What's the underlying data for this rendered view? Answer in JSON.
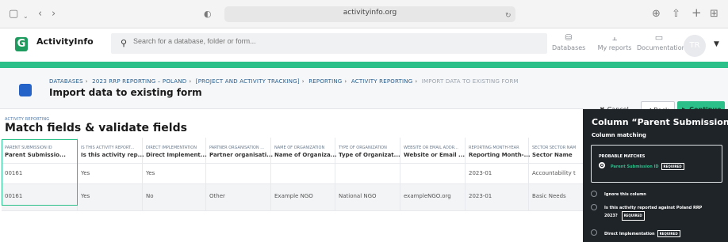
{
  "browser": {
    "url": "activityinfo.org"
  },
  "header": {
    "brand": "ActivityInfo",
    "search_placeholder": "Search for a database, folder or form...",
    "links": [
      {
        "label": "Databases",
        "icon": "database-icon"
      },
      {
        "label": "My reports",
        "icon": "chart-icon"
      },
      {
        "label": "Documentation",
        "icon": "book-icon"
      }
    ],
    "avatar_initials": "TR"
  },
  "breadcrumb": {
    "items": [
      "DATABASES",
      "2023 RRP REPORTING – POLAND",
      "[PROJECT AND ACTIVITY TRACKING]",
      "REPORTING",
      "ACTIVITY REPORTING",
      "IMPORT DATA TO EXISTING FORM"
    ]
  },
  "page": {
    "title": "Import data to existing form",
    "section_small": "ACTIVITY REPORTING",
    "section_title": "Match fields & validate fields"
  },
  "actions": {
    "cancel": "Cancel",
    "back": "Back",
    "continue": "Continue"
  },
  "table": {
    "columns": [
      {
        "small": "PARENT SUBMISSION ID",
        "label": "Parent Submissio..."
      },
      {
        "small": "IS THIS ACTIVITY REPORT...",
        "label": "Is this activity rep..."
      },
      {
        "small": "DIRECT IMPLEMENTATION",
        "label": "Direct Implement..."
      },
      {
        "small": "PARTNER ORGANISATION ...",
        "label": "Partner organisati..."
      },
      {
        "small": "NAME OF ORGANIZATION",
        "label": "Name of Organiza..."
      },
      {
        "small": "TYPE OF ORGANIZATION",
        "label": "Type of Organizat..."
      },
      {
        "small": "WEBSITE OR EMAIL ADDR...",
        "label": "Website or Email ..."
      },
      {
        "small": "REPORTING MONTH-YEAR",
        "label": "Reporting Month-..."
      },
      {
        "small": "SECTOR SECTOR NAM",
        "label": "Sector Name"
      }
    ],
    "rows": [
      [
        "00161",
        "Yes",
        "Yes",
        "",
        "",
        "",
        "",
        "2023-01",
        "Accountability t"
      ],
      [
        "00161",
        "Yes",
        "No",
        "Other",
        "Example NGO",
        "National NGO",
        "exampleNGO.org",
        "2023-01",
        "Basic Needs"
      ]
    ]
  },
  "panel": {
    "title": "Column “Parent Submission I...",
    "subtitle": "Column matching",
    "probable_label": "PROBABLE MATCHES",
    "probable_option": "Parent Submission ID",
    "required": "REQUIRED",
    "options": [
      {
        "label": "Ignore this column",
        "required": false
      },
      {
        "label": "Is this activity reported against Poland RRP 2023?",
        "required": true
      },
      {
        "label": "Direct Implementation",
        "required": true
      }
    ]
  },
  "colors": {
    "accent": "#2bbf8a",
    "panel_bg": "#1f2429",
    "link": "#2a5f8f"
  }
}
